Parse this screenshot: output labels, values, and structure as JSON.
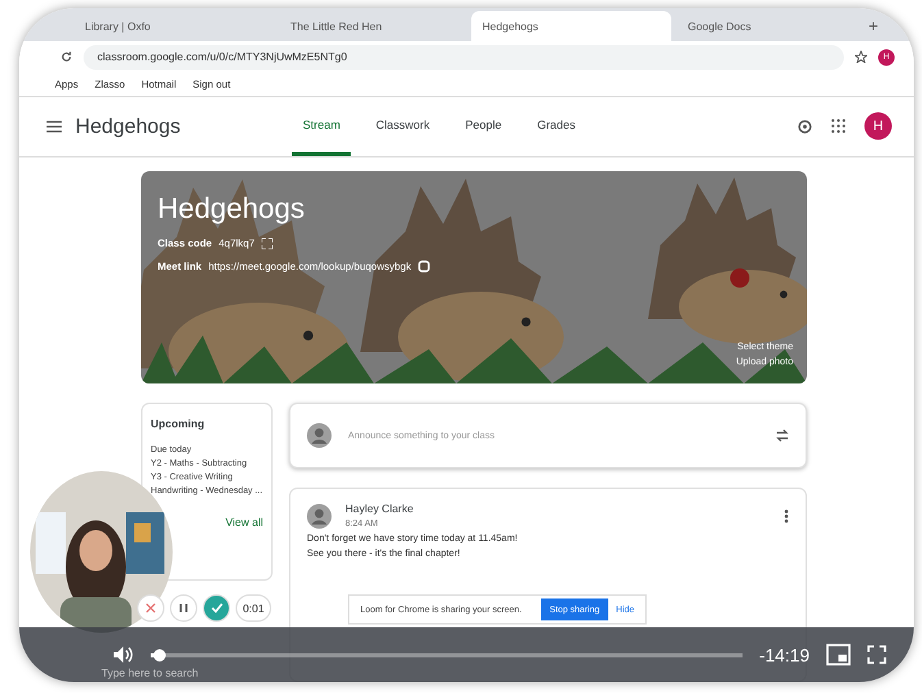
{
  "browser": {
    "tabs": [
      {
        "label": "Library | Oxfo",
        "selected": false
      },
      {
        "label": "The Little Red Hen",
        "selected": false
      },
      {
        "label": "Hedgehogs",
        "selected": true
      },
      {
        "label": "Google Docs",
        "selected": false
      }
    ],
    "new_tab": "+",
    "address": "classroom.google.com/u/0/c/MTY3NjUwMzE5NTg0",
    "avatar": "H",
    "bookmarks": [
      "Apps",
      "Zlasso",
      "Hotmail",
      "Sign out"
    ]
  },
  "header": {
    "title": "Hedgehogs",
    "avatar": "H",
    "tabs": [
      {
        "label": "Stream",
        "selected": true
      },
      {
        "label": "Classwork",
        "selected": false
      },
      {
        "label": "People",
        "selected": false
      },
      {
        "label": "Grades",
        "selected": false
      }
    ]
  },
  "banner": {
    "title": "Hedgehogs",
    "class_code_label": "Class code",
    "class_code": "4q7lkq7",
    "meet_label": "Meet link",
    "meet_link": "https://meet.google.com/lookup/buqowsybgk",
    "links": [
      "Select theme",
      "Upload photo"
    ]
  },
  "upcoming": {
    "title": "Upcoming",
    "due": "Due today",
    "items": [
      "Y2 - Maths - Subtracting",
      "Y3 - Creative Writing",
      "Handwriting - Wednesday ..."
    ],
    "view_all": "View all"
  },
  "announce": {
    "placeholder": "Announce something to your class"
  },
  "post": {
    "author": "Hayley Clarke",
    "time": "8:24 AM",
    "lines": [
      "Don't forget we have story time today at 11.45am!",
      "See you there - it's the final chapter!"
    ]
  },
  "recorder": {
    "timer": "0:01"
  },
  "share_bar": {
    "message": "Loom for Chrome is sharing your screen.",
    "stop": "Stop sharing",
    "hide": "Hide"
  },
  "player": {
    "level": 0.01,
    "remaining": "-14:19",
    "taskbar_search": "Type here to search"
  }
}
